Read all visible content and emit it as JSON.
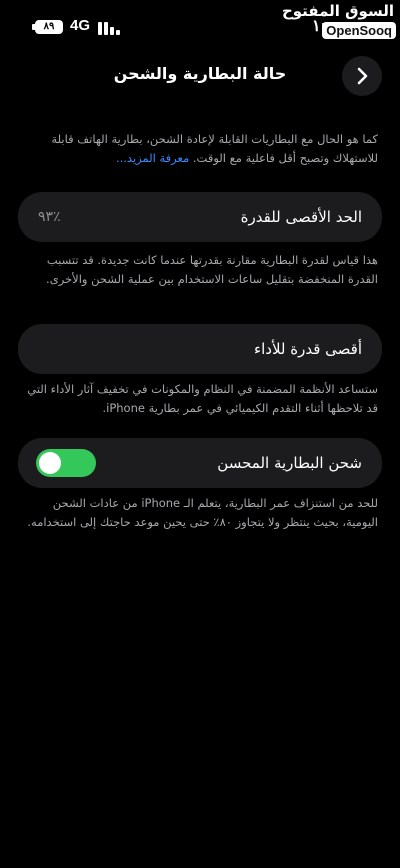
{
  "status_bar": {
    "battery_level": "٨٩",
    "network": "4G",
    "time": "١:"
  },
  "watermark": {
    "arabic": "السوق المفتوح",
    "latin": "OpenSooq"
  },
  "header": {
    "title": "حالة البطارية والشحن"
  },
  "intro": {
    "text": "كما هو الحال مع البطاريات القابلة لإعادة الشحن، بطارية الهاتف قابلة للاستهلاك وتصبح أقل فاعلية مع الوقت.",
    "link": "معرفة المزيد..."
  },
  "max_capacity": {
    "label": "الحد الأقصى للقدرة",
    "value": "٪٩٣",
    "description": "هذا قياس لقدرة البطارية مقارنة بقدرتها عندما كانت جديدة. قد تتسبب القدرة المنخفضة بتقليل ساعات الاستخدام بين عملية الشحن والأخرى."
  },
  "peak_performance": {
    "label": "أقصى قدرة للأداء",
    "description": "ستساعد الأنظمة المضمنة في النظام والمكونات في تخفيف آثار الأداء التي قد تلاحظها أثناء التقدم الكيميائي في عمر بطارية iPhone."
  },
  "optimized_charging": {
    "label": "شحن البطارية المحسن",
    "enabled": true,
    "description": "للحد من استنزاف عمر البطارية، يتعلم الـ iPhone من عادات الشحن اليومية، بحيث ينتظر ولا يتجاوز ٨٠٪ حتى يحين موعد حاجتك إلى استخدامه."
  },
  "colors": {
    "background": "#000000",
    "card": "#1c1c1e",
    "toggle_on": "#34c759",
    "link": "#3d8bff"
  }
}
